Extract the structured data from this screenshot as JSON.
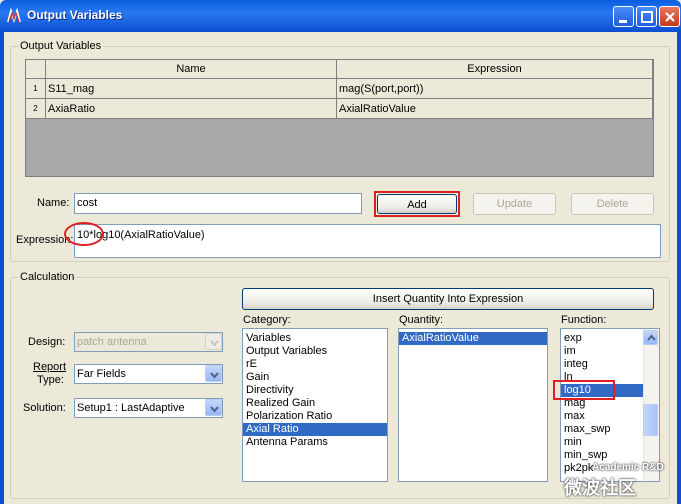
{
  "window": {
    "title": "Output Variables"
  },
  "output_variables": {
    "legend": "Output Variables",
    "columns": [
      "Name",
      "Expression"
    ],
    "rows": [
      {
        "num": "1",
        "name": "S11_mag",
        "expression": "mag(S(port,port))"
      },
      {
        "num": "2",
        "name": "AxiaRatio",
        "expression": "AxialRatioValue"
      }
    ]
  },
  "form": {
    "name_label": "Name:",
    "name_value": "cost",
    "expression_label": "Expression:",
    "expression_value": "10*log10(AxialRatioValue)",
    "add_label": "Add",
    "update_label": "Update",
    "delete_label": "Delete"
  },
  "calculation": {
    "legend": "Calculation",
    "insert_label": "Insert Quantity Into Expression",
    "design_label": "Design:",
    "design_value": "patch antenna",
    "report_type_label_1": "Report",
    "report_type_label_2": "Type:",
    "report_type_value": "Far Fields",
    "solution_label": "Solution:",
    "solution_value": "Setup1 : LastAdaptive",
    "category_label": "Category:",
    "categories": [
      "Variables",
      "Output Variables",
      "rE",
      "Gain",
      "Directivity",
      "Realized Gain",
      "Polarization Ratio",
      "Axial Ratio",
      "Antenna Params"
    ],
    "category_selected": "Axial Ratio",
    "quantity_label": "Quantity:",
    "quantities": [
      "AxialRatioValue"
    ],
    "function_label": "Function:",
    "functions": [
      "exp",
      "im",
      "integ",
      "ln",
      "log10",
      "mag",
      "max",
      "max_swp",
      "min",
      "min_swp",
      "pk2pk"
    ],
    "function_selected": "log10"
  },
  "watermark": {
    "line1": "Academic R&D",
    "line2": "微波社区"
  },
  "colors": {
    "titlebar": "#0a5fe0",
    "selection": "#316ac5",
    "highlight": "#e02020",
    "face": "#ece9d8"
  }
}
